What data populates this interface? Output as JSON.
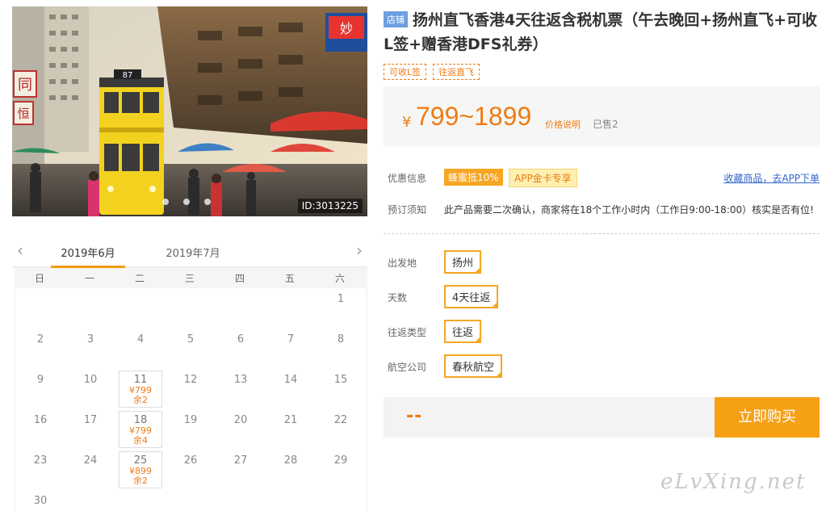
{
  "hero": {
    "image_id": "ID:3013225",
    "photo_description": "Hong Kong street with yellow double-decker tram number 87 and market umbrellas",
    "sign_texts": [
      "妙",
      "同",
      "恒",
      "87"
    ]
  },
  "calendar": {
    "months": [
      "2019年6月",
      "2019年7月"
    ],
    "weekdays": [
      "日",
      "一",
      "二",
      "三",
      "四",
      "五",
      "六"
    ],
    "days": [
      {
        "d": ""
      },
      {
        "d": ""
      },
      {
        "d": ""
      },
      {
        "d": ""
      },
      {
        "d": ""
      },
      {
        "d": ""
      },
      {
        "d": "1"
      },
      {
        "d": "2"
      },
      {
        "d": "3"
      },
      {
        "d": "4"
      },
      {
        "d": "5"
      },
      {
        "d": "6"
      },
      {
        "d": "7"
      },
      {
        "d": "8"
      },
      {
        "d": "9"
      },
      {
        "d": "10"
      },
      {
        "d": "11",
        "price": "¥799",
        "stock": "余2"
      },
      {
        "d": "12"
      },
      {
        "d": "13"
      },
      {
        "d": "14"
      },
      {
        "d": "15"
      },
      {
        "d": "16"
      },
      {
        "d": "17"
      },
      {
        "d": "18",
        "price": "¥799",
        "stock": "余4"
      },
      {
        "d": "19"
      },
      {
        "d": "20"
      },
      {
        "d": "21"
      },
      {
        "d": "22"
      },
      {
        "d": "23"
      },
      {
        "d": "24"
      },
      {
        "d": "25",
        "price": "¥899",
        "stock": "余2"
      },
      {
        "d": "26"
      },
      {
        "d": "27"
      },
      {
        "d": "28"
      },
      {
        "d": "29"
      },
      {
        "d": "30"
      }
    ]
  },
  "product": {
    "shop_badge": "店铺",
    "title": "扬州直飞香港4天往返含税机票（午去晚回+扬州直飞+可收L签+赠香港DFS礼券）",
    "tags": [
      "可收L签",
      "往返直飞"
    ]
  },
  "price": {
    "currency": "¥",
    "range": "799~1899",
    "note": "价格说明",
    "sold": "已售2"
  },
  "promo": {
    "label": "优惠信息",
    "tag1": "蜂蜜抵10%",
    "tag2": "APP金卡专享",
    "link": "收藏商品，去APP下单"
  },
  "booking_notice": {
    "label": "预订须知",
    "text": "此产品需要二次确认，商家将在18个工作小时内（工作日9:00-18:00）核实是否有位!"
  },
  "options": [
    {
      "label": "出发地",
      "value": "扬州"
    },
    {
      "label": "天数",
      "value": "4天往返"
    },
    {
      "label": "往返类型",
      "value": "往返"
    },
    {
      "label": "航空公司",
      "value": "春秋航空"
    }
  ],
  "buy": {
    "total": "--",
    "button": "立即购买"
  },
  "watermark": "eLvXing.net",
  "colors": {
    "accent": "#f07b14",
    "button": "#f6a016",
    "badge": "#6e9fe0",
    "link": "#3366cc"
  }
}
